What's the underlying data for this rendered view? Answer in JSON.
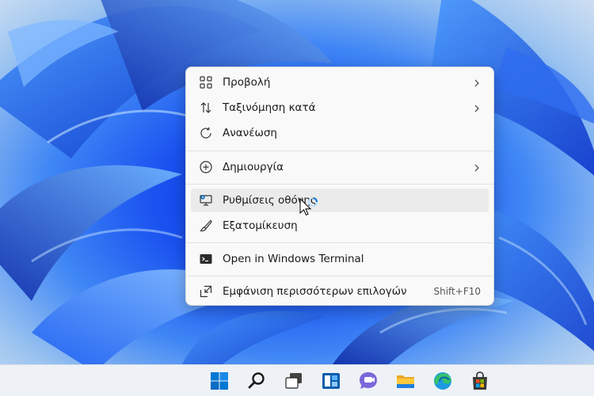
{
  "desktop": {
    "wallpaper": "blue-bloom-wallpaper"
  },
  "context_menu": {
    "items": [
      {
        "label": "Προβολή",
        "icon": "view-grid-icon",
        "has_submenu": true
      },
      {
        "label": "Ταξινόμηση κατά",
        "icon": "sort-arrows-icon",
        "has_submenu": true
      },
      {
        "label": "Ανανέωση",
        "icon": "refresh-icon",
        "has_submenu": false
      },
      {
        "label": "Δημιουργία",
        "icon": "new-plus-icon",
        "has_submenu": true
      },
      {
        "label": "Ρυθμίσεις οθόνης",
        "icon": "display-settings-icon",
        "has_submenu": false,
        "highlighted": true
      },
      {
        "label": "Εξατομίκευση",
        "icon": "personalize-brush-icon",
        "has_submenu": false
      },
      {
        "label": "Open in Windows Terminal",
        "icon": "terminal-icon",
        "has_submenu": false
      },
      {
        "label": "Εμφάνιση περισσότερων επιλογών",
        "icon": "show-more-options-icon",
        "has_submenu": false,
        "shortcut": "Shift+F10"
      }
    ]
  },
  "taskbar": {
    "icons": [
      "windows-start-icon",
      "search-icon",
      "task-view-icon",
      "widgets-icon",
      "teams-chat-icon",
      "file-explorer-icon",
      "edge-browser-icon",
      "microsoft-store-icon"
    ]
  },
  "colors": {
    "menu_background": "#f9f9f9",
    "menu_highlight": "#ebebeb",
    "taskbar_background": "#eef2f7",
    "accent": "#0067c0"
  }
}
